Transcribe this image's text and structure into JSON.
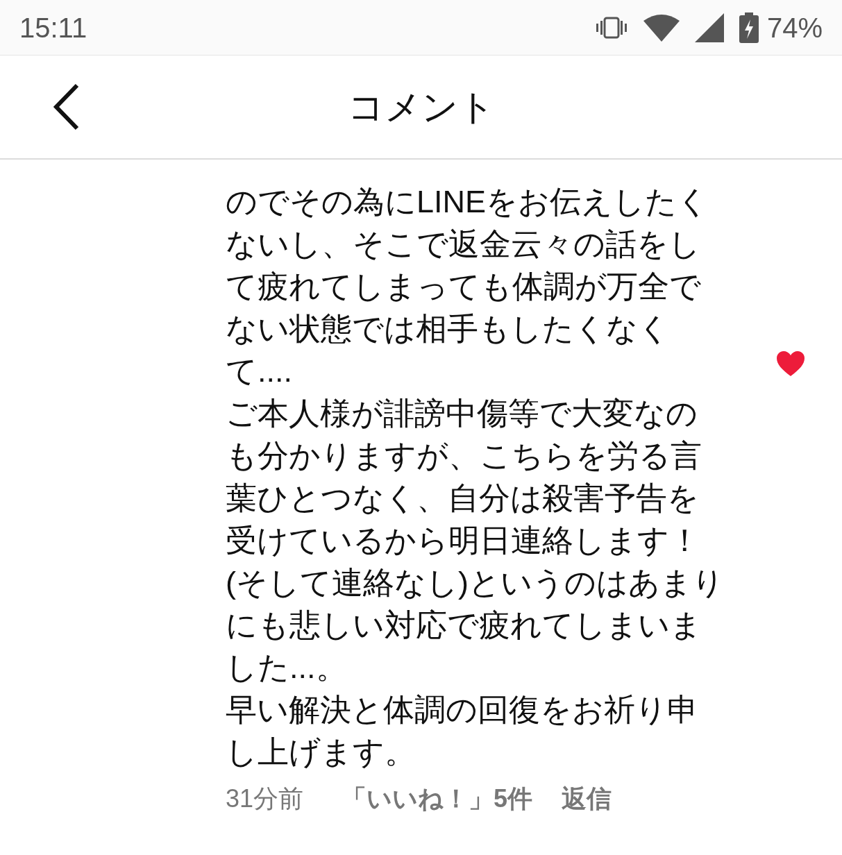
{
  "status_bar": {
    "time": "15:11",
    "battery": "74%"
  },
  "header": {
    "title": "コメント"
  },
  "comment": {
    "lines": [
      "のでその為にLINEをお伝えしたく",
      "ないし、そこで返金云々の話をし",
      "て疲れてしまっても体調が万全で",
      "ない状態では相手もしたくなく",
      "て....",
      "ご本人様が誹謗中傷等で大変なの",
      "も分かりますが、こちらを労る言",
      "葉ひとつなく、自分は殺害予告を",
      "受けているから明日連絡します！",
      "(そして連絡なし)というのはあまり",
      "にも悲しい対応で疲れてしまいま",
      "した...。",
      "早い解決と体調の回復をお祈り申",
      "し上げます。"
    ],
    "liked": true,
    "time": "31分前",
    "likes": "「いいね！」5件",
    "reply": "返信"
  }
}
